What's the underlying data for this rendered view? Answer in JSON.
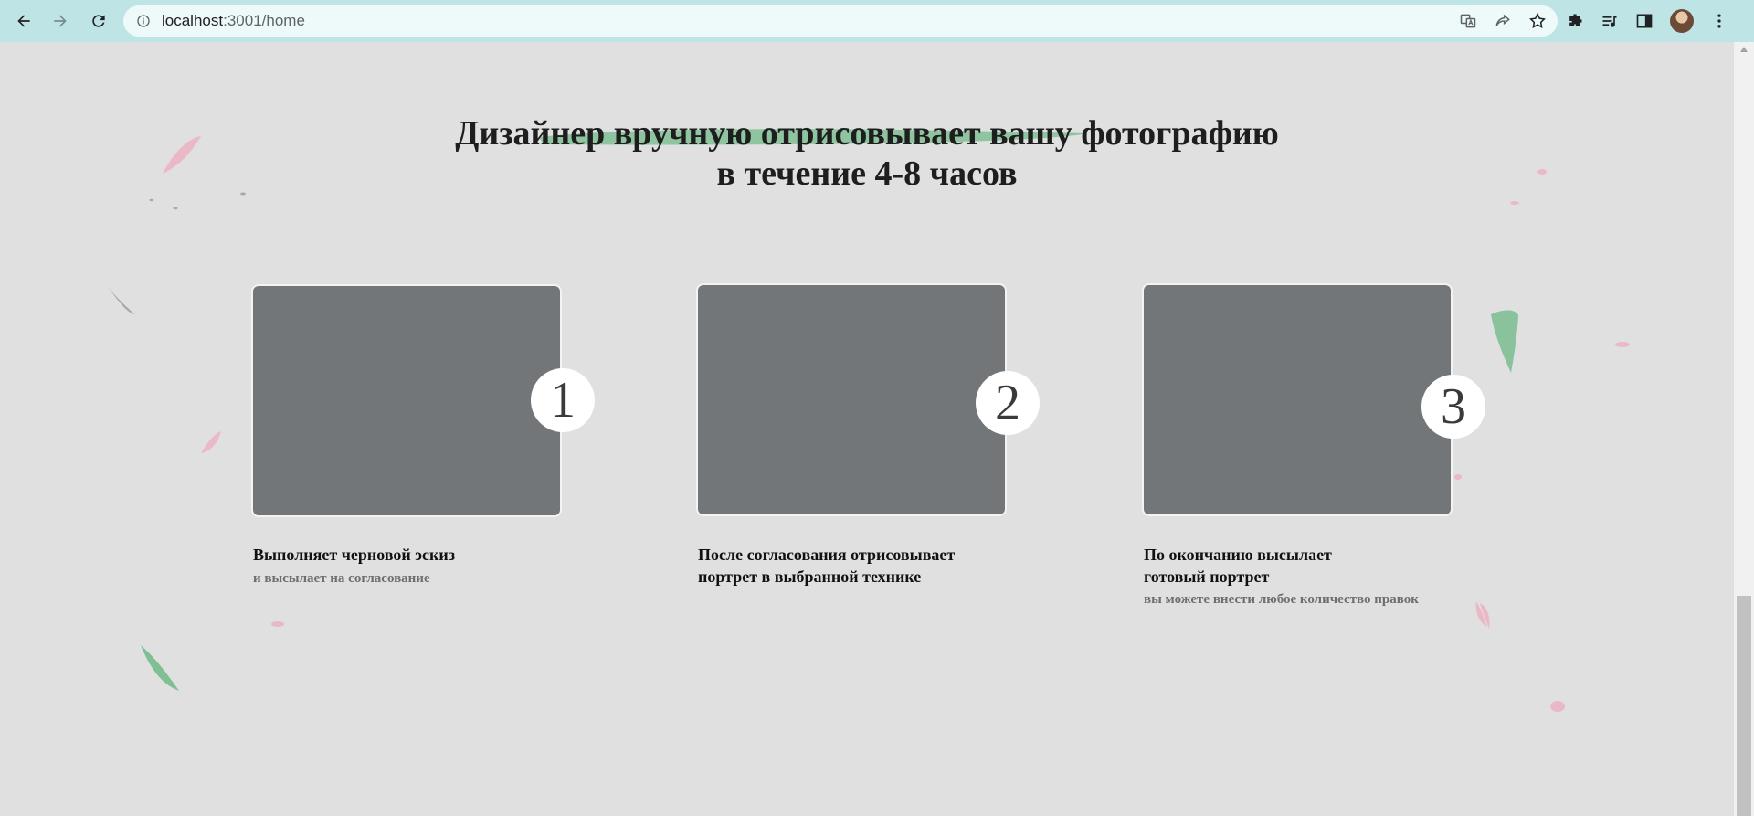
{
  "browser": {
    "url_host": "localhost",
    "url_port_path": ":3001/home",
    "icons": [
      "back-icon",
      "forward-icon",
      "reload-icon",
      "info-icon",
      "translate-icon",
      "share-icon",
      "bookmark-star-icon",
      "extensions-icon",
      "media-playlist-icon",
      "side-panel-icon",
      "profile-avatar",
      "menu-icon"
    ]
  },
  "hero": {
    "line1": "Дизайнер вручную отрисовывает вашу фотографию",
    "line2": "в течение 4-8 часов",
    "brush_color": "#7fbf94"
  },
  "steps": [
    {
      "number": "1",
      "title_line1": "Выполняет черновой эскиз",
      "title_line2": "",
      "subtitle": "и высылает на согласование"
    },
    {
      "number": "2",
      "title_line1": "После согласования отрисовывает",
      "title_line2": "портрет в выбранной технике",
      "subtitle": ""
    },
    {
      "number": "3",
      "title_line1": "По окончанию высылает",
      "title_line2": "готовый портрет",
      "subtitle": "вы можете внести любое количество правок"
    }
  ],
  "colors": {
    "page_bg": "#e0e0e0",
    "toolbar_bg": "#bfe4e6",
    "card_bg": "#737679",
    "petal_pink": "#eab8c6",
    "petal_green": "#7fbf94"
  }
}
